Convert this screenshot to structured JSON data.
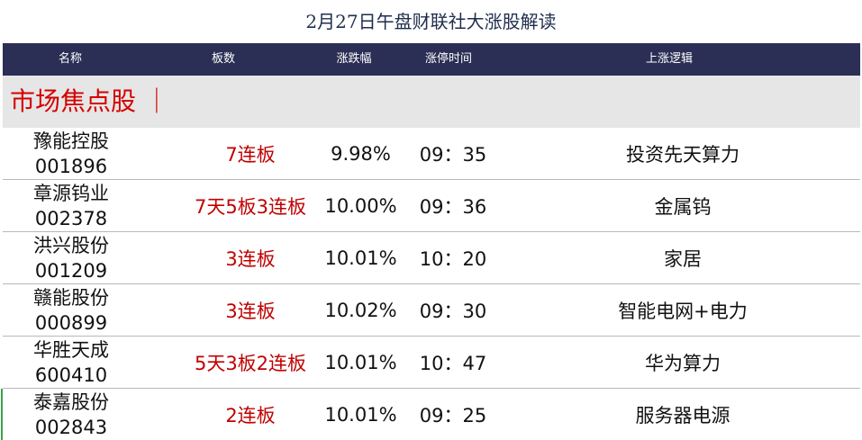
{
  "title": "2月27日午盘财联社大涨股解读",
  "columns": [
    "名称",
    "板数",
    "涨跌幅",
    "涨停时间",
    "上涨逻辑"
  ],
  "section_label": "市场焦点股 ｜",
  "rows": [
    {
      "name": "豫能控股",
      "code": "001896",
      "board": "7连板",
      "change": "9.98%",
      "time": "09：35",
      "logic": "投资先天算力"
    },
    {
      "name": "章源钨业",
      "code": "002378",
      "board": "7天5板3连板",
      "change": "10.00%",
      "time": "09：36",
      "logic": "金属钨"
    },
    {
      "name": "洪兴股份",
      "code": "001209",
      "board": "3连板",
      "change": "10.01%",
      "time": "10：20",
      "logic": "家居"
    },
    {
      "name": "赣能股份",
      "code": "000899",
      "board": "3连板",
      "change": "10.02%",
      "time": "09：30",
      "logic": "智能电网+电力"
    },
    {
      "name": "华胜天成",
      "code": "600410",
      "board": "5天3板2连板",
      "change": "10.01%",
      "time": "10：47",
      "logic": "华为算力"
    },
    {
      "name": "泰嘉股份",
      "code": "002843",
      "board": "2连板",
      "change": "10.01%",
      "time": "09：25",
      "logic": "服务器电源"
    }
  ],
  "colors": {
    "header_bg": "#2b2f55",
    "board_text": "#c00000",
    "section_bg": "#e6e6e6",
    "section_text": "#d40000"
  }
}
